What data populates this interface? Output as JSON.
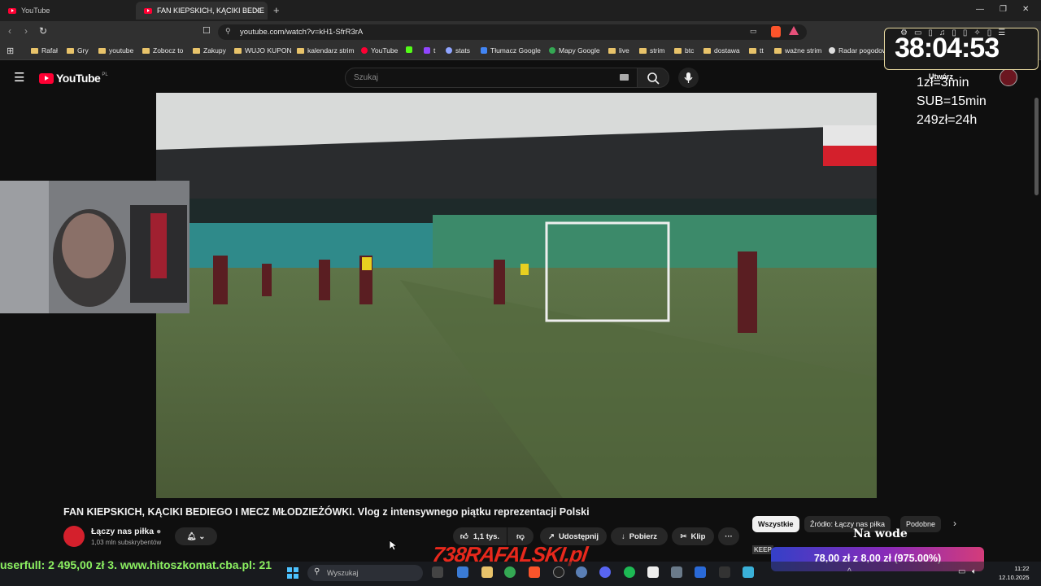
{
  "browser": {
    "tabs": [
      {
        "label": "YouTube"
      },
      {
        "label": "FAN KIEPSKICH, KĄCIKI BEDIE"
      }
    ],
    "url": "youtube.com/watch?v=kH1-SfrR3rA",
    "bookmarks": [
      "Rafał",
      "Gry",
      "youtube",
      "Zobocz to",
      "Zakupy",
      "WUJO KUPON",
      "kalendarz strim",
      "YouTube",
      "t",
      "stats",
      "Tłumacz Google",
      "Mapy Google",
      "live",
      "strim",
      "btc",
      "dostawa",
      "tt",
      "ważne strim",
      "Radar pogodowy"
    ]
  },
  "youtube": {
    "logo_text": "YouTube",
    "region": "PL",
    "search_placeholder": "Szukaj",
    "create_label": "Utwórz"
  },
  "overlay": {
    "timer": "38:04:53",
    "rates": [
      "1zł=3min",
      "SUB=15min",
      "249zł=24h"
    ],
    "ticker": "userfull: 2 495,00 zł    3. www.hitoszkomat.cba.pl: 21",
    "brand": "738RAFALSKI.pl",
    "donation": "78,00 zł z 8,00 zł (975.00%)",
    "na_wode": "Na wode",
    "keep": "KEEP"
  },
  "video": {
    "title": "FAN KIEPSKICH, KĄCIKI BEDIEGO I MECZ MŁODZIEŻÓWKI. Vlog z intensywnego piątku reprezentacji Polski",
    "channel": "Łączy nas piłka",
    "subscribers": "1,03 mln subskrybentów",
    "likes": "1,1 tys.",
    "share": "Udostępnij",
    "download": "Pobierz",
    "clip": "Klip"
  },
  "chips": [
    "Wszystkie",
    "Źródło: Łączy nas piłka",
    "Podobne"
  ],
  "taskbar": {
    "search_placeholder": "Wyszukaj",
    "time": "11:22",
    "date": "12.10.2025"
  },
  "colors": {
    "yt_red": "#ff0033",
    "background": "#0f0f0f"
  }
}
